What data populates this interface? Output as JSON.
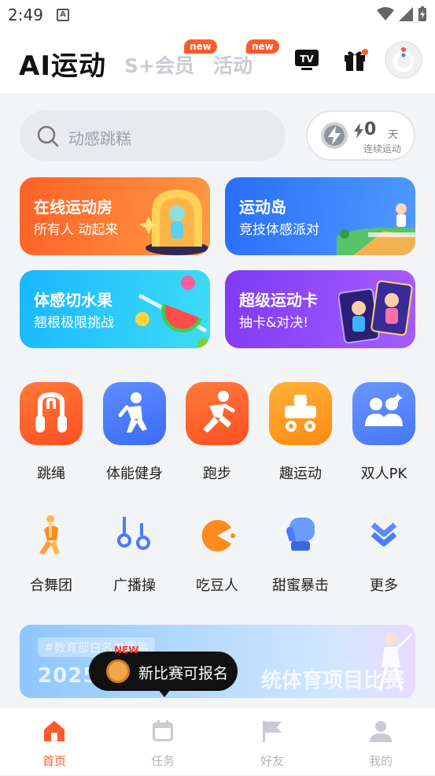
{
  "status_bar": {
    "time": "2:49",
    "notification_icon": "A"
  },
  "header": {
    "title": "AI运动",
    "tabs": [
      {
        "label": "S+会员",
        "badge": "new"
      },
      {
        "label": "活动",
        "badge": "new"
      }
    ],
    "icons": [
      "tv-icon",
      "gift-icon",
      "avatar"
    ],
    "tv_label": "TV"
  },
  "search": {
    "placeholder": "动感跳糕"
  },
  "streak": {
    "count": "0",
    "unit": "天",
    "label": "连续运动"
  },
  "feature_cards": [
    {
      "title": "在线运动房",
      "subtitle": "所有人 动起来",
      "color_from": "#ff6b2c",
      "color_to": "#ffa04a"
    },
    {
      "title": "运动岛",
      "subtitle": "竞技体感派对",
      "color_from": "#2f7bff",
      "color_to": "#5aa8ff"
    },
    {
      "title": "体感切水果",
      "subtitle": "翘根极限挑战",
      "color_from": "#18b9ff",
      "color_to": "#4de0ff"
    },
    {
      "title": "超级运动卡",
      "subtitle": "抽卡&对决!",
      "color_from": "#8a3cff",
      "color_to": "#b46bff"
    }
  ],
  "main_icons": [
    {
      "label": "跳绳",
      "icon": "jump-rope-icon",
      "color": "#ff5a2a"
    },
    {
      "label": "体能健身",
      "icon": "fitness-icon",
      "color": "#4a7bff"
    },
    {
      "label": "跑步",
      "icon": "running-icon",
      "color": "#ff5a2a"
    },
    {
      "label": "趣运动",
      "icon": "fun-sports-icon",
      "color": "#ff8a1e"
    },
    {
      "label": "双人PK",
      "icon": "two-player-icon",
      "color": "#4a7bff"
    }
  ],
  "secondary_icons": [
    {
      "label": "合舞团",
      "icon": "dance-icon"
    },
    {
      "label": "广播操",
      "icon": "broadcast-exercise-icon"
    },
    {
      "label": "吃豆人",
      "icon": "pacman-icon"
    },
    {
      "label": "甜蜜暴击",
      "icon": "boxing-glove-icon"
    },
    {
      "label": "更多",
      "icon": "more-icon"
    }
  ],
  "banner": {
    "tag": "#教育部白名单赛事",
    "text_left": "2025",
    "text_right": "统体育项目比赛"
  },
  "toast": {
    "text": "新比赛可报名",
    "new_label": "NEW"
  },
  "tabbar": [
    {
      "label": "首页",
      "icon": "home-icon",
      "active": true
    },
    {
      "label": "任务",
      "icon": "calendar-icon",
      "active": false
    },
    {
      "label": "好友",
      "icon": "flag-icon",
      "active": false
    },
    {
      "label": "我的",
      "icon": "profile-icon",
      "active": false
    }
  ],
  "colors": {
    "accent": "#ff5a2a",
    "inactive": "#b4b6bb"
  }
}
